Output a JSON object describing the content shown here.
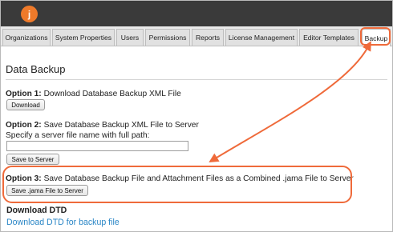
{
  "app": {
    "logo_letter": "j",
    "brand_color": "#ef7a2a",
    "topbar_color": "#3a3a3a"
  },
  "tabs": [
    {
      "label": "Organizations"
    },
    {
      "label": "System Properties"
    },
    {
      "label": "Users"
    },
    {
      "label": "Permissions"
    },
    {
      "label": "Reports"
    },
    {
      "label": "License Management"
    },
    {
      "label": "Editor Templates"
    },
    {
      "label": "Backup",
      "active": true
    }
  ],
  "page": {
    "title": "Data Backup"
  },
  "option1": {
    "prefix": "Option 1:",
    "text": "Download Database Backup XML File",
    "button": "Download"
  },
  "option2": {
    "prefix": "Option 2:",
    "text": "Save Database Backup XML File to Server",
    "instruction": "Specify a server file name with full path:",
    "field_value": "",
    "button": "Save to Server"
  },
  "option3": {
    "prefix": "Option 3:",
    "text": "Save Database Backup File and Attachment Files as a Combined .jama File to Server",
    "button": "Save .jama File to Server"
  },
  "dtd": {
    "heading": "Download DTD",
    "link": "Download DTD for backup file"
  },
  "annotation": {
    "highlight_color": "#ef6a3a"
  }
}
